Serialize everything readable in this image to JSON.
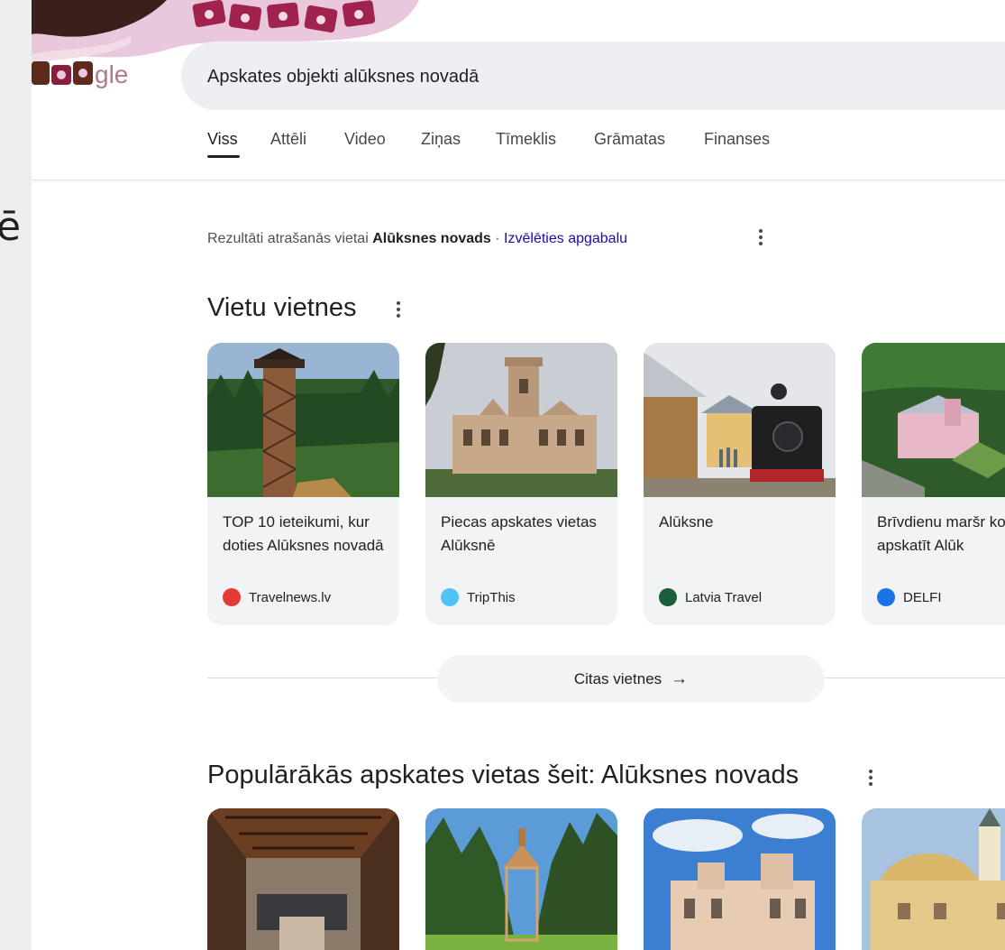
{
  "left_edge_text": "ē",
  "logo": {
    "text": "Google",
    "partial_visible": "gle"
  },
  "search": {
    "query": "Apskates objekti alūksnes novadā"
  },
  "tabs": [
    {
      "label": "Viss",
      "active": true
    },
    {
      "label": "Attēli"
    },
    {
      "label": "Video"
    },
    {
      "label": "Ziņas"
    },
    {
      "label": "Tīmeklis"
    },
    {
      "label": "Grāmatas"
    },
    {
      "label": "Finanses"
    }
  ],
  "location": {
    "prefix": "Rezultāti atrašanās vietai",
    "place": "Alūksnes novads",
    "separator": " · ",
    "change_link": "Izvēlēties apgabalu"
  },
  "sites_section": {
    "title": "Vietu vietnes",
    "cards": [
      {
        "title": "TOP 10 ieteikumi, kur doties Alūksnes novadā",
        "source": "Travelnews.lv",
        "favicon_color": "#e53935"
      },
      {
        "title": "Piecas apskates vietas Alūksnē",
        "source": "TripThis",
        "favicon_color": "#4fc3f7"
      },
      {
        "title": "Alūksne",
        "source": "Latvia Travel",
        "favicon_color": "#1b5e3b"
      },
      {
        "title": "Brīvdienu maršr ko apskatīt Alūk",
        "source": "DELFI",
        "favicon_color": "#1a73e8"
      }
    ],
    "more_button": "Citas vietnes"
  },
  "popular_section": {
    "title": "Populārākās apskates vietas šeit: Alūksnes novads"
  },
  "colors": {
    "link": "#1a0dab",
    "card_bg": "#f1f3f4",
    "search_bg": "#eeeff2"
  }
}
